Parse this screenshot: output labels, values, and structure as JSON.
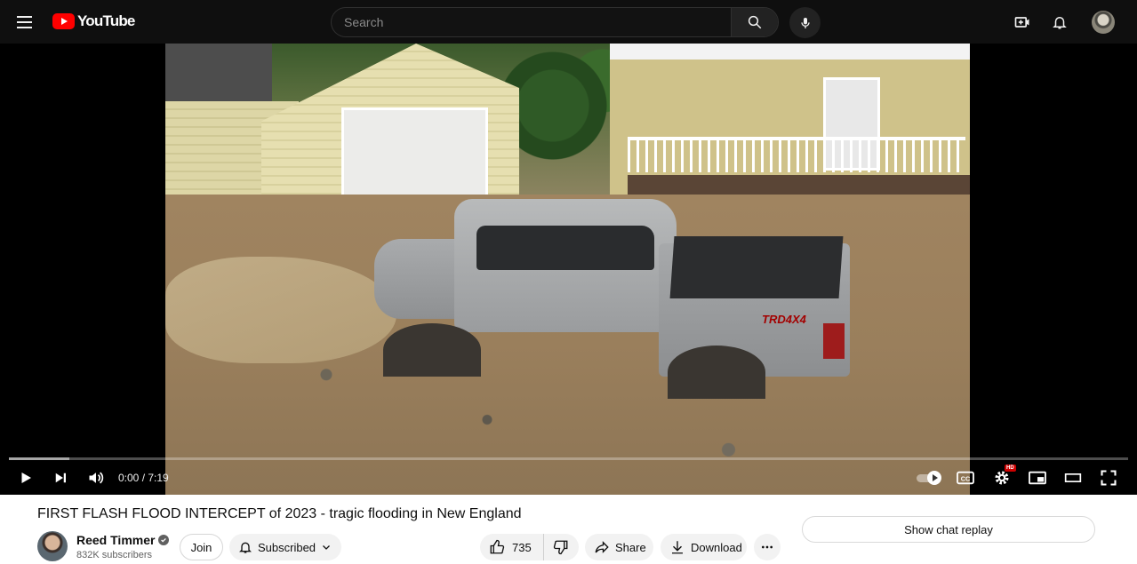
{
  "header": {
    "logo_text": "YouTube",
    "search_placeholder": "Search",
    "brand_red": "#ff0000"
  },
  "player": {
    "time_display": "0:00 / 7:19",
    "progress_fraction": 0.0,
    "truck_badge": "TRD4X4",
    "hd_badge": "HD",
    "autoplay_on": true
  },
  "video": {
    "title": "FIRST FLASH FLOOD INTERCEPT of 2023 - tragic flooding in New England"
  },
  "channel": {
    "name": "Reed Timmer",
    "verified": true,
    "subscribers": "832K subscribers",
    "join_label": "Join",
    "subscribed_label": "Subscribed"
  },
  "actions": {
    "like_count": "735",
    "share_label": "Share",
    "download_label": "Download"
  },
  "sidebar": {
    "chat_replay_label": "Show chat replay"
  },
  "icons": [
    "menu-icon",
    "youtube-logo-icon",
    "search-icon",
    "mic-icon",
    "create-icon",
    "bell-icon",
    "play-icon",
    "next-icon",
    "volume-icon",
    "autoplay-toggle-icon",
    "captions-icon",
    "settings-icon",
    "miniplayer-icon",
    "theater-icon",
    "fullscreen-icon",
    "verified-icon",
    "bell-outline-icon",
    "chevron-down-icon",
    "thumbs-up-icon",
    "thumbs-down-icon",
    "share-icon",
    "download-icon",
    "more-icon"
  ]
}
